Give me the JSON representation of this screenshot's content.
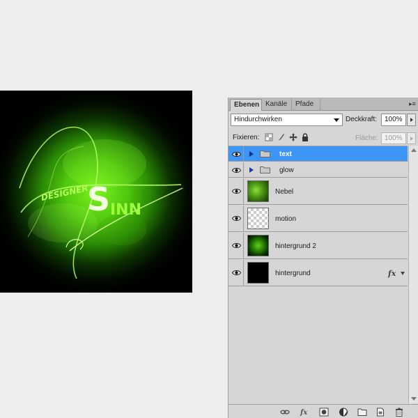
{
  "tabs": [
    {
      "label": "Ebenen"
    },
    {
      "label": "Kanäle"
    },
    {
      "label": "Pfade"
    }
  ],
  "panel_menu_icon": "panel-menu-icon",
  "blend_mode": "Hindurchwirken",
  "opacity": {
    "label": "Deckkraft:",
    "value": "100%"
  },
  "lock": {
    "label": "Fixieren:",
    "icons": [
      "lock-transparency-icon",
      "lock-brush-icon",
      "lock-move-icon",
      "lock-all-icon"
    ]
  },
  "fill": {
    "label": "Fläche:",
    "value": "100%"
  },
  "layers": [
    {
      "name": "text",
      "type": "group",
      "selected": true
    },
    {
      "name": "glow",
      "type": "group",
      "selected": false
    },
    {
      "name": "Nebel",
      "type": "layer",
      "thumb": "nebel"
    },
    {
      "name": "motion",
      "type": "layer",
      "thumb": "transparent"
    },
    {
      "name": "hintergrund 2",
      "type": "layer",
      "thumb": "glow"
    },
    {
      "name": "hintergrund",
      "type": "layer",
      "thumb": "black",
      "fx": "fx"
    }
  ],
  "canvas": {
    "logo_text_1": "DESIGNER",
    "logo_text_2": "S",
    "logo_text_3": "INN"
  },
  "footer_icons": [
    "link-layers-icon",
    "fx-icon",
    "mask-icon",
    "adjustment-layer-icon",
    "new-group-icon",
    "new-layer-icon",
    "trash-icon"
  ],
  "colors": {
    "selection": "#3d95f5",
    "panel": "#d6d6d6",
    "glow": "#7df21e"
  }
}
